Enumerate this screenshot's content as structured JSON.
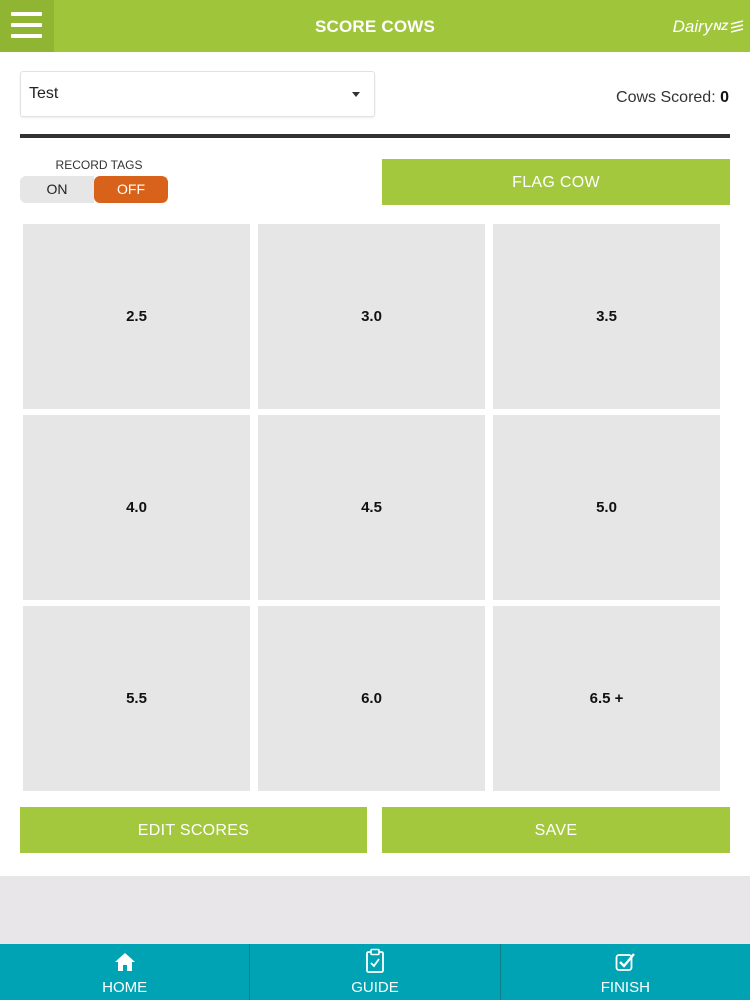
{
  "header": {
    "title": "SCORE COWS",
    "logo_text": "Dairy",
    "logo_suffix": "NZ",
    "menu_icon": "hamburger-menu-icon"
  },
  "herd_select": {
    "value": "Test"
  },
  "cows_scored": {
    "label": "Cows Scored:",
    "count": "0"
  },
  "record_tags": {
    "label": "RECORD TAGS",
    "on_label": "ON",
    "off_label": "OFF",
    "selected": "OFF"
  },
  "actions": {
    "flag_cow": "FLAG COW",
    "edit_scores": "EDIT SCORES",
    "save": "SAVE"
  },
  "scores": [
    "2.5",
    "3.0",
    "3.5",
    "4.0",
    "4.5",
    "5.0",
    "5.5",
    "6.0",
    "6.5 +"
  ],
  "nav": [
    {
      "label": "HOME",
      "icon": "home-icon"
    },
    {
      "label": "GUIDE",
      "icon": "clipboard-check-icon"
    },
    {
      "label": "FINISH",
      "icon": "checkbox-icon"
    }
  ],
  "colors": {
    "header_green": "#9fc63b",
    "button_green": "#a3c83e",
    "toggle_orange": "#d8621a",
    "nav_teal": "#00a3b4"
  }
}
